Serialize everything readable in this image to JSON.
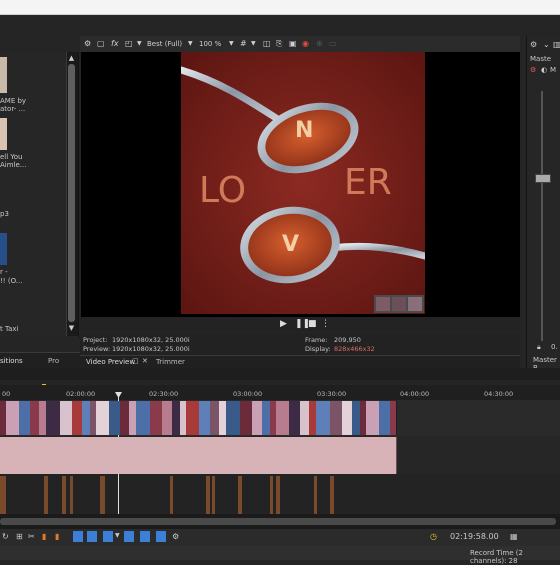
{
  "media": {
    "items": [
      {
        "label1": "AME by",
        "label2": "ator- ..."
      },
      {
        "label1": "ell You",
        "label2": "Aimle..."
      },
      {
        "label1": "p3",
        "label2": ""
      },
      {
        "label1": "r -",
        "label2": "!! (O..."
      },
      {
        "label1": "t Taxi",
        "label2": ""
      }
    ],
    "tab_transitions": "sitions",
    "tab_projects": "Pro"
  },
  "preview": {
    "quality": "Best (Full)",
    "zoom": "100 %",
    "project_label": "Project:",
    "project_value": "1920x1080x32, 25.000i",
    "preview_label": "Preview:",
    "preview_value": "1920x1080x32, 25.000i",
    "frame_label": "Frame:",
    "frame_value": "209,950",
    "display_label": "Display:",
    "display_value": "828x466x32",
    "tab_video_preview": "Video Preview",
    "tab_trimmer": "Trimmer",
    "spoon_text_1": "N",
    "spoon_text_2": "V",
    "backdrop_text_1": "LO",
    "backdrop_text_2": "ER"
  },
  "master": {
    "label": "Maste",
    "m_label": "M",
    "bus_label": "Master B",
    "level_value": "0.",
    "level_fraction": 0.2
  },
  "timeline": {
    "ticks": [
      "00",
      "02:00:00",
      "02:30:00",
      "03:00:00",
      "03:30:00",
      "04:00:00",
      "04:30:00"
    ],
    "time_display": "02:19:58.00",
    "record_time": "Record Time (2 channels): 28"
  },
  "colors": {
    "accent_blue": "#3c7fd6",
    "background_red": "#7a1f1a",
    "audio_clip": "#d7b3b8",
    "clip_orange": "#e07b2a"
  }
}
